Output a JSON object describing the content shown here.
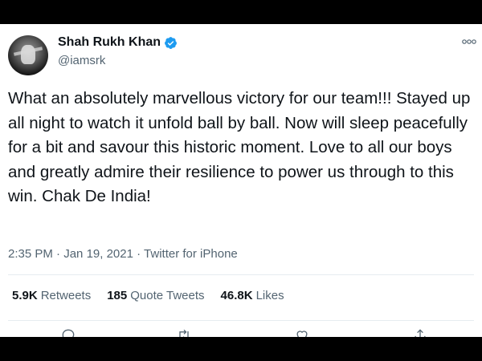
{
  "author": {
    "display_name": "Shah Rukh Khan",
    "handle": "@iamsrk"
  },
  "tweet": {
    "text": "What an absolutely marvellous victory for our team!!! Stayed up all night to watch it unfold ball by ball. Now will sleep peacefully for a bit and savour this historic moment. Love to all our boys and greatly admire their resilience to power us through to this win. Chak De India!"
  },
  "meta": {
    "time": "2:35 PM",
    "separator": " · ",
    "date": "Jan 19, 2021",
    "source": "Twitter for iPhone"
  },
  "stats": {
    "retweets_count": "5.9K",
    "retweets_label": "Retweets",
    "quotes_count": "185",
    "quotes_label": "Quote Tweets",
    "likes_count": "46.8K",
    "likes_label": "Likes"
  },
  "colors": {
    "verified": "#1d9bf0",
    "muted": "#536471",
    "text": "#0f1419"
  },
  "icons": [
    "verified-badge-icon",
    "more-options-icon",
    "reply-icon",
    "retweet-icon",
    "like-icon",
    "share-icon"
  ]
}
